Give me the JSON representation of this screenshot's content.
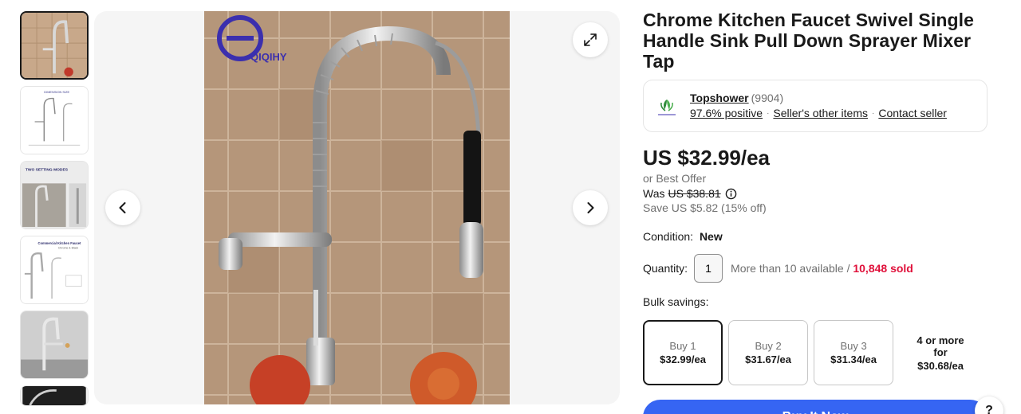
{
  "product": {
    "title": "Chrome Kitchen Faucet Swivel Single Handle Sink Pull Down Sprayer Mixer Tap"
  },
  "gallery": {
    "thumbnails": [
      {
        "name": "thumb-faucet-main"
      },
      {
        "name": "thumb-dimension-diagram"
      },
      {
        "name": "thumb-two-setting-modes"
      },
      {
        "name": "thumb-commercial-chrome-black"
      },
      {
        "name": "thumb-faucet-in-sink"
      },
      {
        "name": "thumb-faucet-closeup"
      }
    ],
    "watermark_text": "QIQIHY",
    "thumb_labels": {
      "dimension": "DIMENSION SIZE",
      "two_modes": "TWO SETTING MODES",
      "commercial": "Commercial Kitchen Faucet",
      "chrome_black": "Chrome & Black"
    }
  },
  "seller": {
    "name": "Topshower",
    "count": "(9904)",
    "positive": "97.6% positive",
    "other_items": "Seller's other items",
    "contact": "Contact seller"
  },
  "pricing": {
    "price": "US $32.99/ea",
    "best_offer": "or Best Offer",
    "was_label": "Was",
    "was_value": "US $38.81",
    "save": "Save US $5.82 (15% off)"
  },
  "condition": {
    "label": "Condition:",
    "value": "New"
  },
  "quantity": {
    "label": "Quantity:",
    "value": "1",
    "available": "More than 10 available /",
    "sold": "10,848 sold"
  },
  "bulk": {
    "label": "Bulk savings:",
    "options": [
      {
        "qty": "Buy 1",
        "price": "$32.99/ea"
      },
      {
        "qty": "Buy 2",
        "price": "$31.67/ea"
      },
      {
        "qty": "Buy 3",
        "price": "$31.34/ea"
      },
      {
        "qty_line1": "4 or more",
        "qty_line2": "for",
        "price": "$30.68/ea"
      }
    ]
  },
  "actions": {
    "buy_now": "Buy It Now",
    "help": "?"
  },
  "colors": {
    "accent": "#3665f3",
    "sold_red": "#e0103a",
    "text": "#191919",
    "muted": "#707070"
  }
}
